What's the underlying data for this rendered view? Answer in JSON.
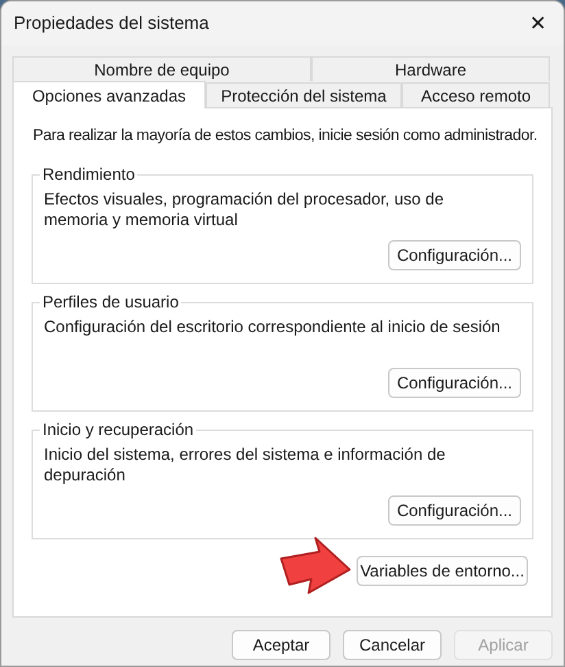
{
  "window": {
    "title": "Propiedades del sistema",
    "close": "✕"
  },
  "tab_rows": [
    [
      {
        "label": "Nombre de equipo",
        "selected": false
      },
      {
        "label": "Hardware",
        "selected": false
      }
    ],
    [
      {
        "label": "Opciones avanzadas",
        "selected": true
      },
      {
        "label": "Protección del sistema",
        "selected": false
      },
      {
        "label": "Acceso remoto",
        "selected": false
      }
    ]
  ],
  "intro": "Para realizar la mayoría de estos cambios, inicie sesión como administrador.",
  "groups": [
    {
      "title": "Rendimiento",
      "description": "Efectos visuales, programación del procesador, uso de memoria y memoria virtual",
      "button": "Configuración..."
    },
    {
      "title": "Perfiles de usuario",
      "description": "Configuración del escritorio correspondiente al inicio de sesión",
      "button": "Configuración..."
    },
    {
      "title": "Inicio y recuperación",
      "description": "Inicio del sistema, errores del sistema e información de depuración",
      "button": "Configuración..."
    }
  ],
  "environment_button": "Variables de entorno...",
  "buttons": [
    {
      "label": "Aceptar",
      "disabled": false
    },
    {
      "label": "Cancelar",
      "disabled": false
    },
    {
      "label": "Aplicar",
      "disabled": true
    }
  ]
}
